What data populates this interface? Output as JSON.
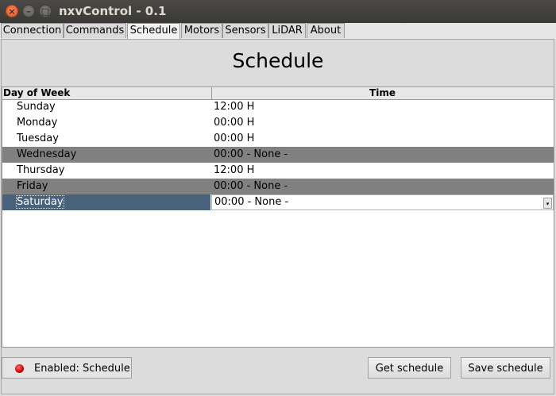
{
  "window": {
    "title": "nxvControl - 0.1",
    "close_glyph": "×",
    "min_glyph": "–",
    "max_glyph": "□"
  },
  "tabs": [
    {
      "label": "Connection"
    },
    {
      "label": "Commands"
    },
    {
      "label": "Schedule",
      "active": true
    },
    {
      "label": "Motors"
    },
    {
      "label": "Sensors"
    },
    {
      "label": "LiDAR"
    },
    {
      "label": "About"
    }
  ],
  "page": {
    "heading": "Schedule"
  },
  "table": {
    "columns": [
      "Day of Week",
      "Time"
    ],
    "rows": [
      {
        "day": "Sunday",
        "time": "12:00 H"
      },
      {
        "day": "Monday",
        "time": "00:00 H"
      },
      {
        "day": "Tuesday",
        "time": "00:00 H"
      },
      {
        "day": "Wednesday",
        "time": "00:00 - None -",
        "disabled": true
      },
      {
        "day": "Thursday",
        "time": "12:00 H"
      },
      {
        "day": "Friday",
        "time": "00:00 - None -",
        "disabled": true
      },
      {
        "day": "Saturday",
        "time": "00:00 - None -",
        "selected": true
      }
    ]
  },
  "status": {
    "indicator_color": "#d40000",
    "text": "Enabled: Schedule"
  },
  "buttons": {
    "get": "Get schedule",
    "save": "Save schedule"
  },
  "icons": {
    "dropdown": "▾",
    "status": "red-led-icon"
  }
}
